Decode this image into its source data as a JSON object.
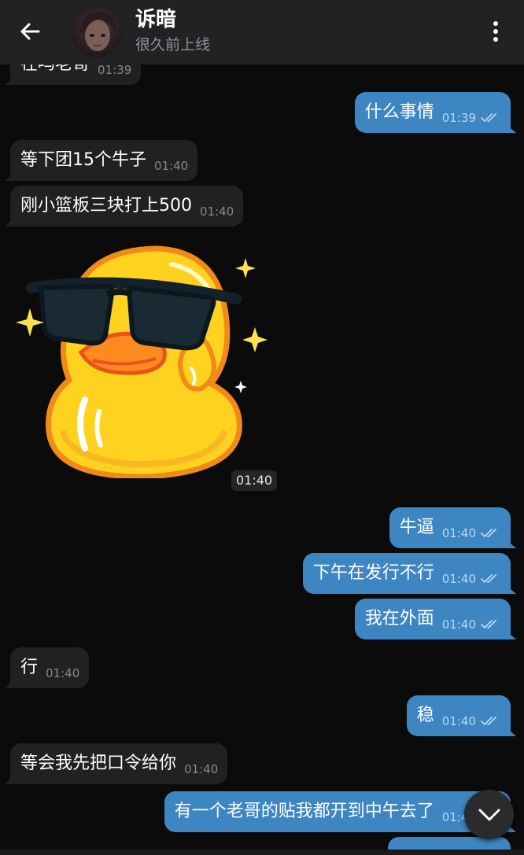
{
  "header": {
    "contact_name": "诉暗",
    "status": "很久前上线",
    "back_icon": "arrow-left-icon",
    "menu_icon": "more-vertical-icon"
  },
  "messages": [
    {
      "dir": "in",
      "text": "在吗老哥",
      "time": "01:39"
    },
    {
      "dir": "out",
      "text": "什么事情",
      "time": "01:39",
      "read": true
    },
    {
      "dir": "in",
      "text": "等下团15个牛子",
      "time": "01:40"
    },
    {
      "dir": "in",
      "text": "刚小篮板三块打上500",
      "time": "01:40"
    },
    {
      "dir": "out",
      "text": "牛逼",
      "time": "01:40",
      "read": true
    },
    {
      "dir": "out",
      "text": "下午在发行不行",
      "time": "01:40",
      "read": true
    },
    {
      "dir": "out",
      "text": "我在外面",
      "time": "01:40",
      "read": true
    },
    {
      "dir": "in",
      "text": "行",
      "time": "01:40"
    },
    {
      "dir": "out",
      "text": "稳",
      "time": "01:40",
      "read": true
    },
    {
      "dir": "in",
      "text": "等会我先把口令给你",
      "time": "01:40"
    },
    {
      "dir": "out",
      "text": "有一个老哥的贴我都开到中午去了",
      "time": "01:40",
      "read": true
    }
  ],
  "sticker": {
    "description_icon": "duck-sunglasses-sticker",
    "time": "01:40"
  },
  "scroll_button": {
    "icon": "chevron-down-icon"
  },
  "colors": {
    "background": "#0b0b0c",
    "header": "#222224",
    "incoming_bubble": "#212123",
    "outgoing_bubble": "#3d86c2"
  }
}
